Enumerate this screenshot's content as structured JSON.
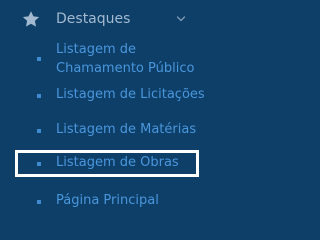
{
  "menu": {
    "section": {
      "label": "Destaques",
      "icon": "star-icon",
      "toggle_icon": "chevron-down-icon",
      "expanded": true
    },
    "items": [
      {
        "label": "Listagem de Chamamento Público",
        "icon": "bullet-icon",
        "highlighted": false
      },
      {
        "label": "Listagem de Licitações",
        "icon": "bullet-icon",
        "highlighted": false
      },
      {
        "label": "Listagem de Matérias",
        "icon": "bullet-icon",
        "highlighted": false
      },
      {
        "label": "Listagem de Obras",
        "icon": "bullet-icon",
        "highlighted": true
      },
      {
        "label": "Página Principal",
        "icon": "bullet-icon",
        "highlighted": false
      }
    ]
  },
  "colors": {
    "background": "#0d3f69",
    "section_text": "#a2b9cf",
    "item_text": "#4a96dc",
    "bullet": "#3f8ad0",
    "highlight_border": "#ffffff"
  }
}
